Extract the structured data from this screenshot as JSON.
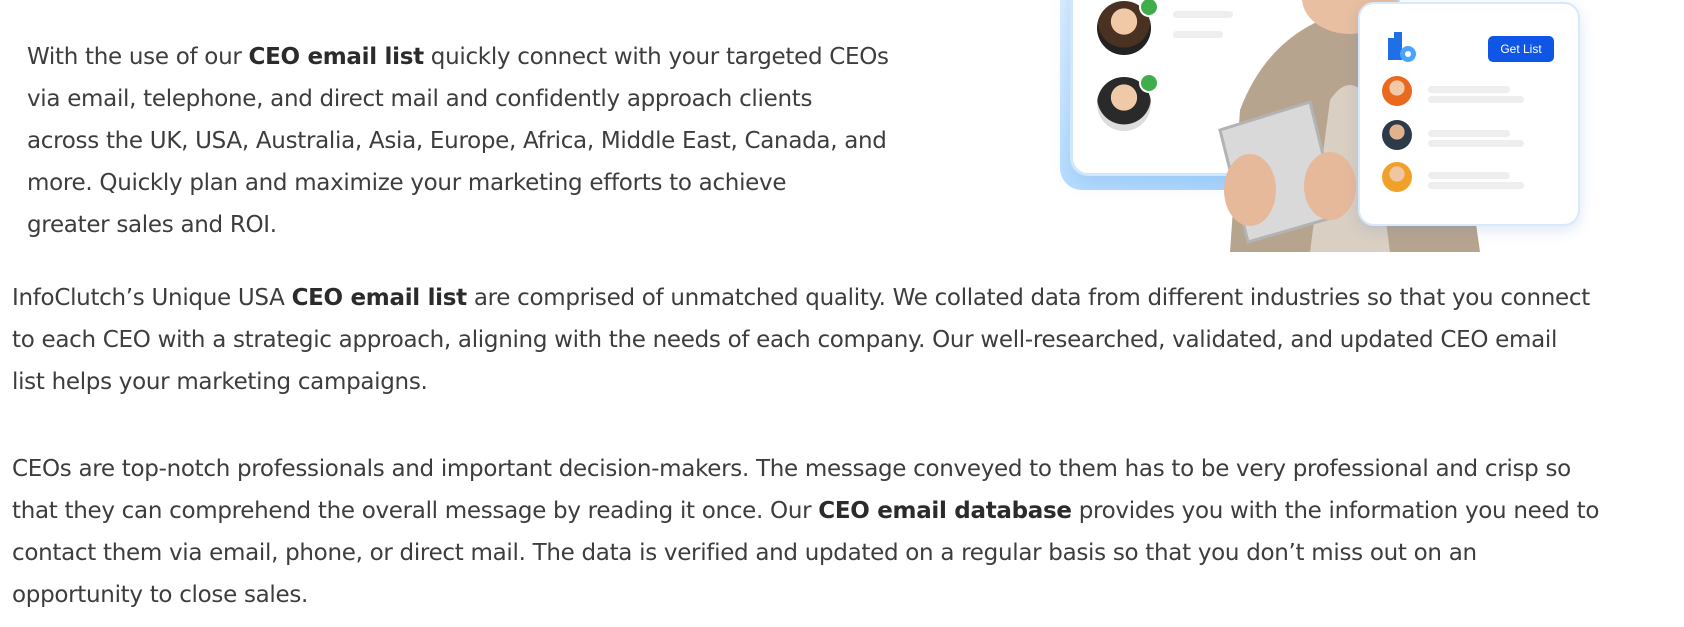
{
  "intro": {
    "lines": [
      [
        {
          "t": "With the use of our "
        },
        {
          "t": "CEO email list",
          "b": true
        },
        {
          "t": " quickly connect with your targeted CEOs"
        }
      ],
      [
        {
          "t": "via email, telephone, and direct mail and confidently approach clients"
        }
      ],
      [
        {
          "t": "across the UK, USA, Australia, Asia, Europe, Africa, Middle East, Canada, and"
        }
      ],
      [
        {
          "t": "more. Quickly plan and maximize your marketing efforts to achieve"
        }
      ],
      [
        {
          "t": "greater sales and ROI."
        }
      ]
    ]
  },
  "quality": {
    "lines": [
      [
        {
          "t": "InfoClutch’s Unique USA "
        },
        {
          "t": "CEO email list",
          "b": true
        },
        {
          "t": " are comprised of unmatched quality. We collated data from different industries so that you connect"
        }
      ],
      [
        {
          "t": "to each CEO with a strategic approach, aligning with the needs of each company. Our well-researched, validated, and updated CEO email"
        }
      ],
      [
        {
          "t": "list helps your marketing campaigns."
        }
      ]
    ]
  },
  "decision_makers": {
    "lines": [
      [
        {
          "t": "CEOs are top-notch professionals and important decision-makers. The message conveyed to them has to be very professional and crisp so"
        }
      ],
      [
        {
          "t": "that they can comprehend the overall message by reading it once. Our "
        },
        {
          "t": "CEO email database",
          "b": true
        },
        {
          "t": "  provides you with the information you need to"
        }
      ],
      [
        {
          "t": "contact them via email, phone, or direct mail. The data is verified and updated on a regular basis so that you don’t miss out on an"
        }
      ],
      [
        {
          "t": "opportunity to close sales."
        }
      ]
    ]
  },
  "illustration": {
    "get_list_label": "Get List",
    "icons": [
      "building-gear-icon",
      "checkmark-icon"
    ],
    "colors": {
      "accent": "#1056e6",
      "check": "#3fae4a",
      "panel_border": "#cfe6fb"
    }
  }
}
